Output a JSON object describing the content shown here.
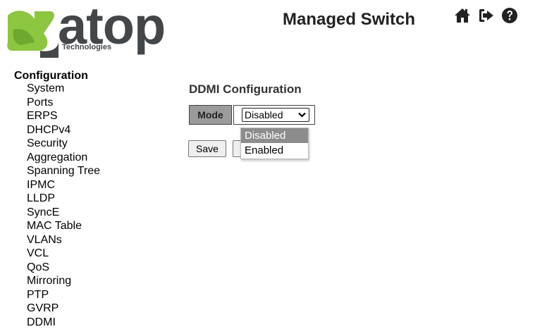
{
  "brand": {
    "name": "atop",
    "tagline": "Technologies"
  },
  "header": {
    "title": "Managed Switch",
    "icons": [
      "home-icon",
      "logout-icon",
      "help-icon"
    ]
  },
  "sidebar": {
    "title": "Configuration",
    "items": [
      {
        "label": "System"
      },
      {
        "label": "Ports"
      },
      {
        "label": "ERPS"
      },
      {
        "label": "DHCPv4"
      },
      {
        "label": "Security"
      },
      {
        "label": "Aggregation"
      },
      {
        "label": "Spanning Tree"
      },
      {
        "label": "IPMC"
      },
      {
        "label": "LLDP"
      },
      {
        "label": "SyncE"
      },
      {
        "label": "MAC Table"
      },
      {
        "label": "VLANs"
      },
      {
        "label": "VCL"
      },
      {
        "label": "QoS"
      },
      {
        "label": "Mirroring"
      },
      {
        "label": "PTP"
      },
      {
        "label": "GVRP"
      },
      {
        "label": "DDMI"
      }
    ]
  },
  "main": {
    "title": "DDMI Configuration",
    "mode": {
      "label": "Mode",
      "value": "Disabled",
      "options": [
        "Disabled",
        "Enabled"
      ]
    },
    "buttons": {
      "save": "Save"
    }
  },
  "colors": {
    "logo_green": "#8dc63f",
    "logo_text": "#44474a",
    "mode_header_bg": "#9b9b9b",
    "selected_option_bg": "#8c8c8c"
  }
}
